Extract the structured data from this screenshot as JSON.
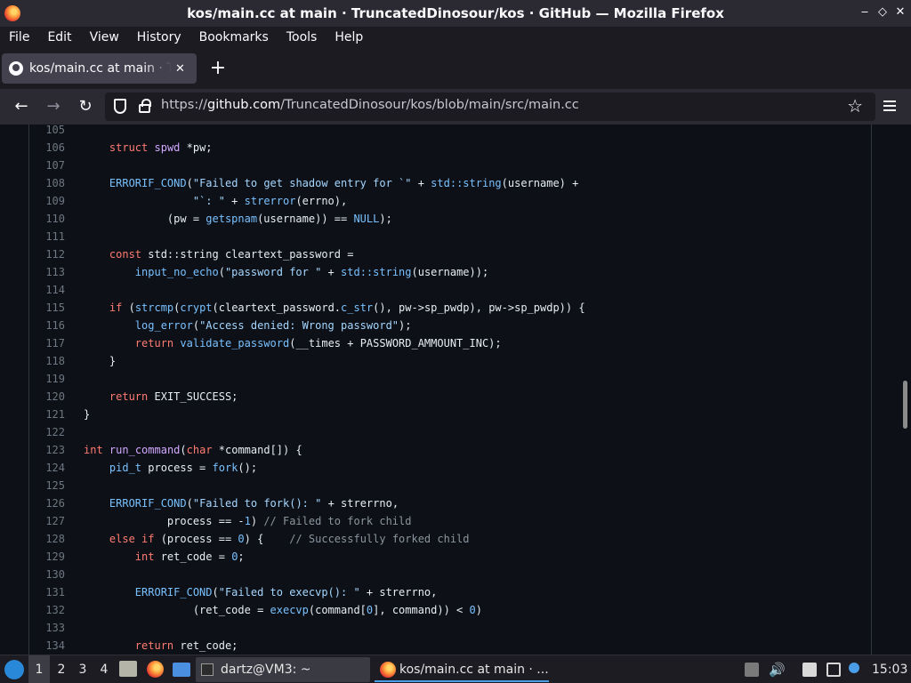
{
  "window": {
    "title": "kos/main.cc at main · TruncatedDinosour/kos · GitHub — Mozilla Firefox"
  },
  "menu": [
    "File",
    "Edit",
    "View",
    "History",
    "Bookmarks",
    "Tools",
    "Help"
  ],
  "tab": {
    "label": "kos/main.cc at main · TruncatedDinosour/kos",
    "close": "✕",
    "new": "+"
  },
  "nav": {
    "url_scheme": "https://",
    "url_host": "github.com",
    "url_path": "/TruncatedDinosour/kos/blob/main/src/main.cc"
  },
  "code_lines": [
    {
      "n": "105",
      "c": ""
    },
    {
      "n": "106",
      "c": "    <span class=\"k\">struct</span> <span class=\"f\">spwd</span> *pw;"
    },
    {
      "n": "107",
      "c": ""
    },
    {
      "n": "108",
      "c": "    <span class=\"n\">ERRORIF_COND</span>(<span class=\"s\">\"Failed to get shadow entry for `\"</span> + <span class=\"n\">std::string</span>(username) +"
    },
    {
      "n": "109",
      "c": "                 <span class=\"s\">\"`: \"</span> + <span class=\"n\">strerror</span>(errno),"
    },
    {
      "n": "110",
      "c": "             (pw = <span class=\"n\">getspnam</span>(username)) == <span class=\"n\">NULL</span>);"
    },
    {
      "n": "111",
      "c": ""
    },
    {
      "n": "112",
      "c": "    <span class=\"k\">const</span> std::string cleartext_password ="
    },
    {
      "n": "113",
      "c": "        <span class=\"n\">input_no_echo</span>(<span class=\"s\">\"password for \"</span> + <span class=\"n\">std::string</span>(username));"
    },
    {
      "n": "114",
      "c": ""
    },
    {
      "n": "115",
      "c": "    <span class=\"k\">if</span> (<span class=\"n\">strcmp</span>(<span class=\"n\">crypt</span>(cleartext_password.<span class=\"n\">c_str</span>(), pw->sp_pwdp), pw->sp_pwdp)) {"
    },
    {
      "n": "116",
      "c": "        <span class=\"n\">log_error</span>(<span class=\"s\">\"Access denied: Wrong password\"</span>);"
    },
    {
      "n": "117",
      "c": "        <span class=\"k\">return</span> <span class=\"n\">validate_password</span>(__times + PASSWORD_AMMOUNT_INC);"
    },
    {
      "n": "118",
      "c": "    }"
    },
    {
      "n": "119",
      "c": ""
    },
    {
      "n": "120",
      "c": "    <span class=\"k\">return</span> EXIT_SUCCESS;"
    },
    {
      "n": "121",
      "c": "}"
    },
    {
      "n": "122",
      "c": ""
    },
    {
      "n": "123",
      "c": "<span class=\"k\">int</span> <span class=\"f\">run_command</span>(<span class=\"k\">char</span> *command[]) {"
    },
    {
      "n": "124",
      "c": "    <span class=\"n\">pid_t</span> process = <span class=\"n\">fork</span>();"
    },
    {
      "n": "125",
      "c": ""
    },
    {
      "n": "126",
      "c": "    <span class=\"n\">ERRORIF_COND</span>(<span class=\"s\">\"Failed to fork(): \"</span> + strerrno,"
    },
    {
      "n": "127",
      "c": "             process == -<span class=\"n\">1</span>) <span class=\"c\">// Failed to fork child</span>"
    },
    {
      "n": "128",
      "c": "    <span class=\"k\">else if</span> (process == <span class=\"n\">0</span>) {    <span class=\"c\">// Successfully forked child</span>"
    },
    {
      "n": "129",
      "c": "        <span class=\"k\">int</span> ret_code = <span class=\"n\">0</span>;"
    },
    {
      "n": "130",
      "c": ""
    },
    {
      "n": "131",
      "c": "        <span class=\"n\">ERRORIF_COND</span>(<span class=\"s\">\"Failed to execvp(): \"</span> + strerrno,"
    },
    {
      "n": "132",
      "c": "                 (ret_code = <span class=\"n\">execvp</span>(command[<span class=\"n\">0</span>], command)) < <span class=\"n\">0</span>)"
    },
    {
      "n": "133",
      "c": ""
    },
    {
      "n": "134",
      "c": "        <span class=\"k\">return</span> ret_code;"
    }
  ],
  "taskbar": {
    "workspaces": [
      "1",
      "2",
      "3",
      "4"
    ],
    "terminal_task": "dartz@VM3: ~",
    "firefox_task": "kos/main.cc at main · ...",
    "clock": "15:03"
  }
}
